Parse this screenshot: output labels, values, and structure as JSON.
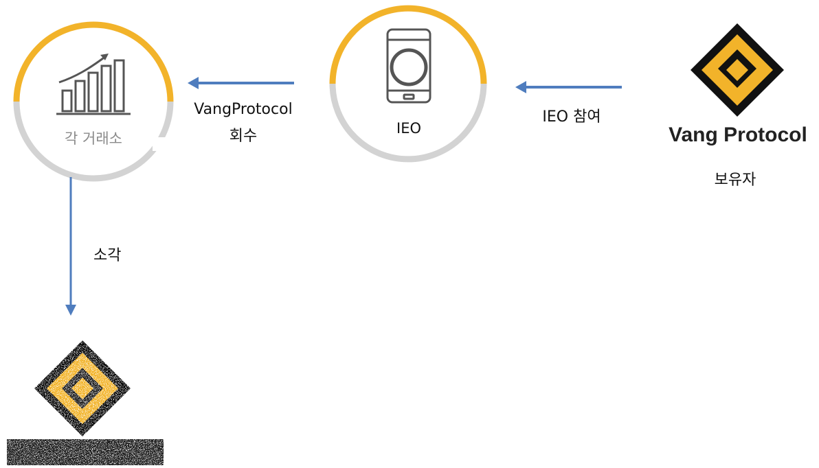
{
  "nodes": {
    "exchanges": {
      "label": "각 거래소",
      "icon": "bar-chart-growth-icon"
    },
    "ieo": {
      "label": "IEO",
      "icon": "smartphone-icon"
    },
    "holder": {
      "brand": "Vang Protocol",
      "label": "보유자",
      "icon": "vang-protocol-logo"
    },
    "burned": {
      "icon": "burned-vang-protocol-logo"
    }
  },
  "edges": {
    "holder_to_ieo": "IEO 참여",
    "ieo_to_exchanges_line1": "VangProtocol",
    "ieo_to_exchanges_line2": "회수",
    "exchanges_to_burn": "소각"
  },
  "colors": {
    "accent_yellow": "#F2B32A",
    "ring_gray": "#D3D3D3",
    "arrow_blue": "#4F7DBE",
    "logo_dark": "#111111"
  }
}
